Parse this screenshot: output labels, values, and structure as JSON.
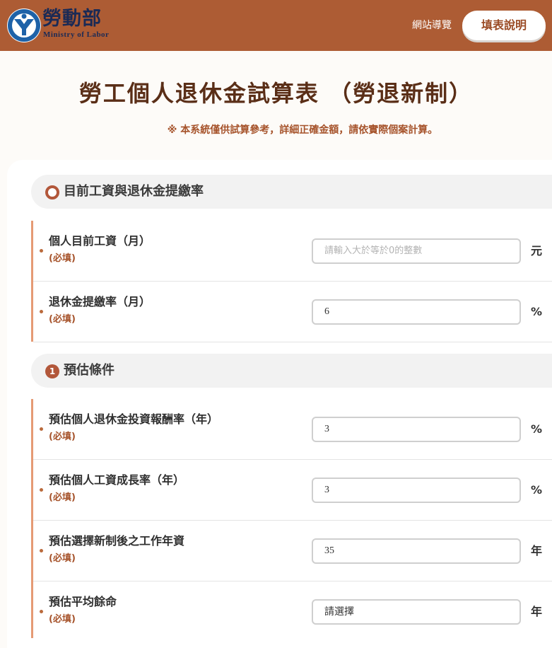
{
  "header": {
    "brand_cn": "勞動部",
    "brand_en": "Ministry of Labor",
    "site_nav_label": "網站導覽",
    "help_button_label": "填表說明"
  },
  "page": {
    "title": "勞工個人退休金試算表 （勞退新制）",
    "notice": "※ 本系統僅供試算參考，詳細正確金額，請依實際個案計算。"
  },
  "section1": {
    "title": "目前工資與退休金提繳率",
    "rows": [
      {
        "label": "個人目前工資（月）",
        "required": "(必填)",
        "value": "",
        "placeholder": "請輸入大於等於0的整數",
        "unit": "元"
      },
      {
        "label": "退休金提繳率（月）",
        "required": "(必填)",
        "value": "6",
        "placeholder": "",
        "unit": "%"
      }
    ]
  },
  "section2": {
    "number": "1",
    "title": "預估條件",
    "rows": [
      {
        "label": "預估個人退休金投資報酬率（年）",
        "required": "(必填)",
        "value": "3",
        "unit": "%"
      },
      {
        "label": "預估個人工資成長率（年）",
        "required": "(必填)",
        "value": "3",
        "unit": "%"
      },
      {
        "label": "預估選擇新制後之工作年資",
        "required": "(必填)",
        "value": "35",
        "unit": "年"
      },
      {
        "label": "預估平均餘命",
        "required": "(必填)",
        "value": "請選擇",
        "unit": "年"
      }
    ]
  },
  "colors": {
    "header_bg": "#ad5c34",
    "accent": "#b2573a",
    "title": "#5a2e17",
    "notice": "#a6532b"
  }
}
